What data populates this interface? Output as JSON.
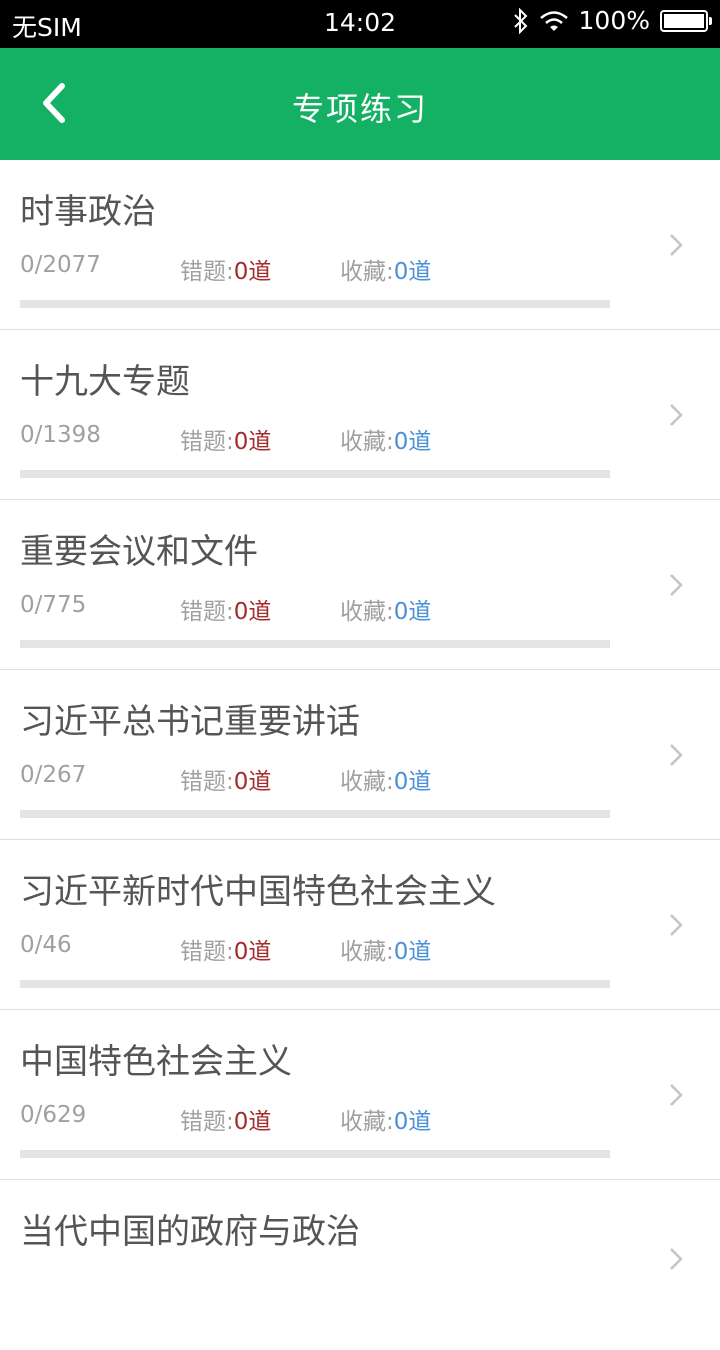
{
  "status_bar": {
    "carrier": "无SIM",
    "time": "14:02",
    "battery_text": "100%",
    "battery_level": 1.0
  },
  "nav": {
    "title": "专项练习"
  },
  "labels": {
    "wrong_prefix": "错题:",
    "fav_prefix": "收藏:"
  },
  "colors": {
    "brand_green": "#14b064",
    "wrong_red": "#a52a2a",
    "fav_blue": "#4a90d9"
  },
  "items": [
    {
      "name": "时事政治",
      "progress": "0/2077",
      "wrong": "0道",
      "fav": "0道",
      "progress_fraction": 0
    },
    {
      "name": "十九大专题",
      "progress": "0/1398",
      "wrong": "0道",
      "fav": "0道",
      "progress_fraction": 0
    },
    {
      "name": "重要会议和文件",
      "progress": "0/775",
      "wrong": "0道",
      "fav": "0道",
      "progress_fraction": 0
    },
    {
      "name": "习近平总书记重要讲话",
      "progress": "0/267",
      "wrong": "0道",
      "fav": "0道",
      "progress_fraction": 0
    },
    {
      "name": "习近平新时代中国特色社会主义",
      "progress": "0/46",
      "wrong": "0道",
      "fav": "0道",
      "progress_fraction": 0
    },
    {
      "name": "中国特色社会主义",
      "progress": "0/629",
      "wrong": "0道",
      "fav": "0道",
      "progress_fraction": 0
    },
    {
      "name": "当代中国的政府与政治"
    }
  ]
}
